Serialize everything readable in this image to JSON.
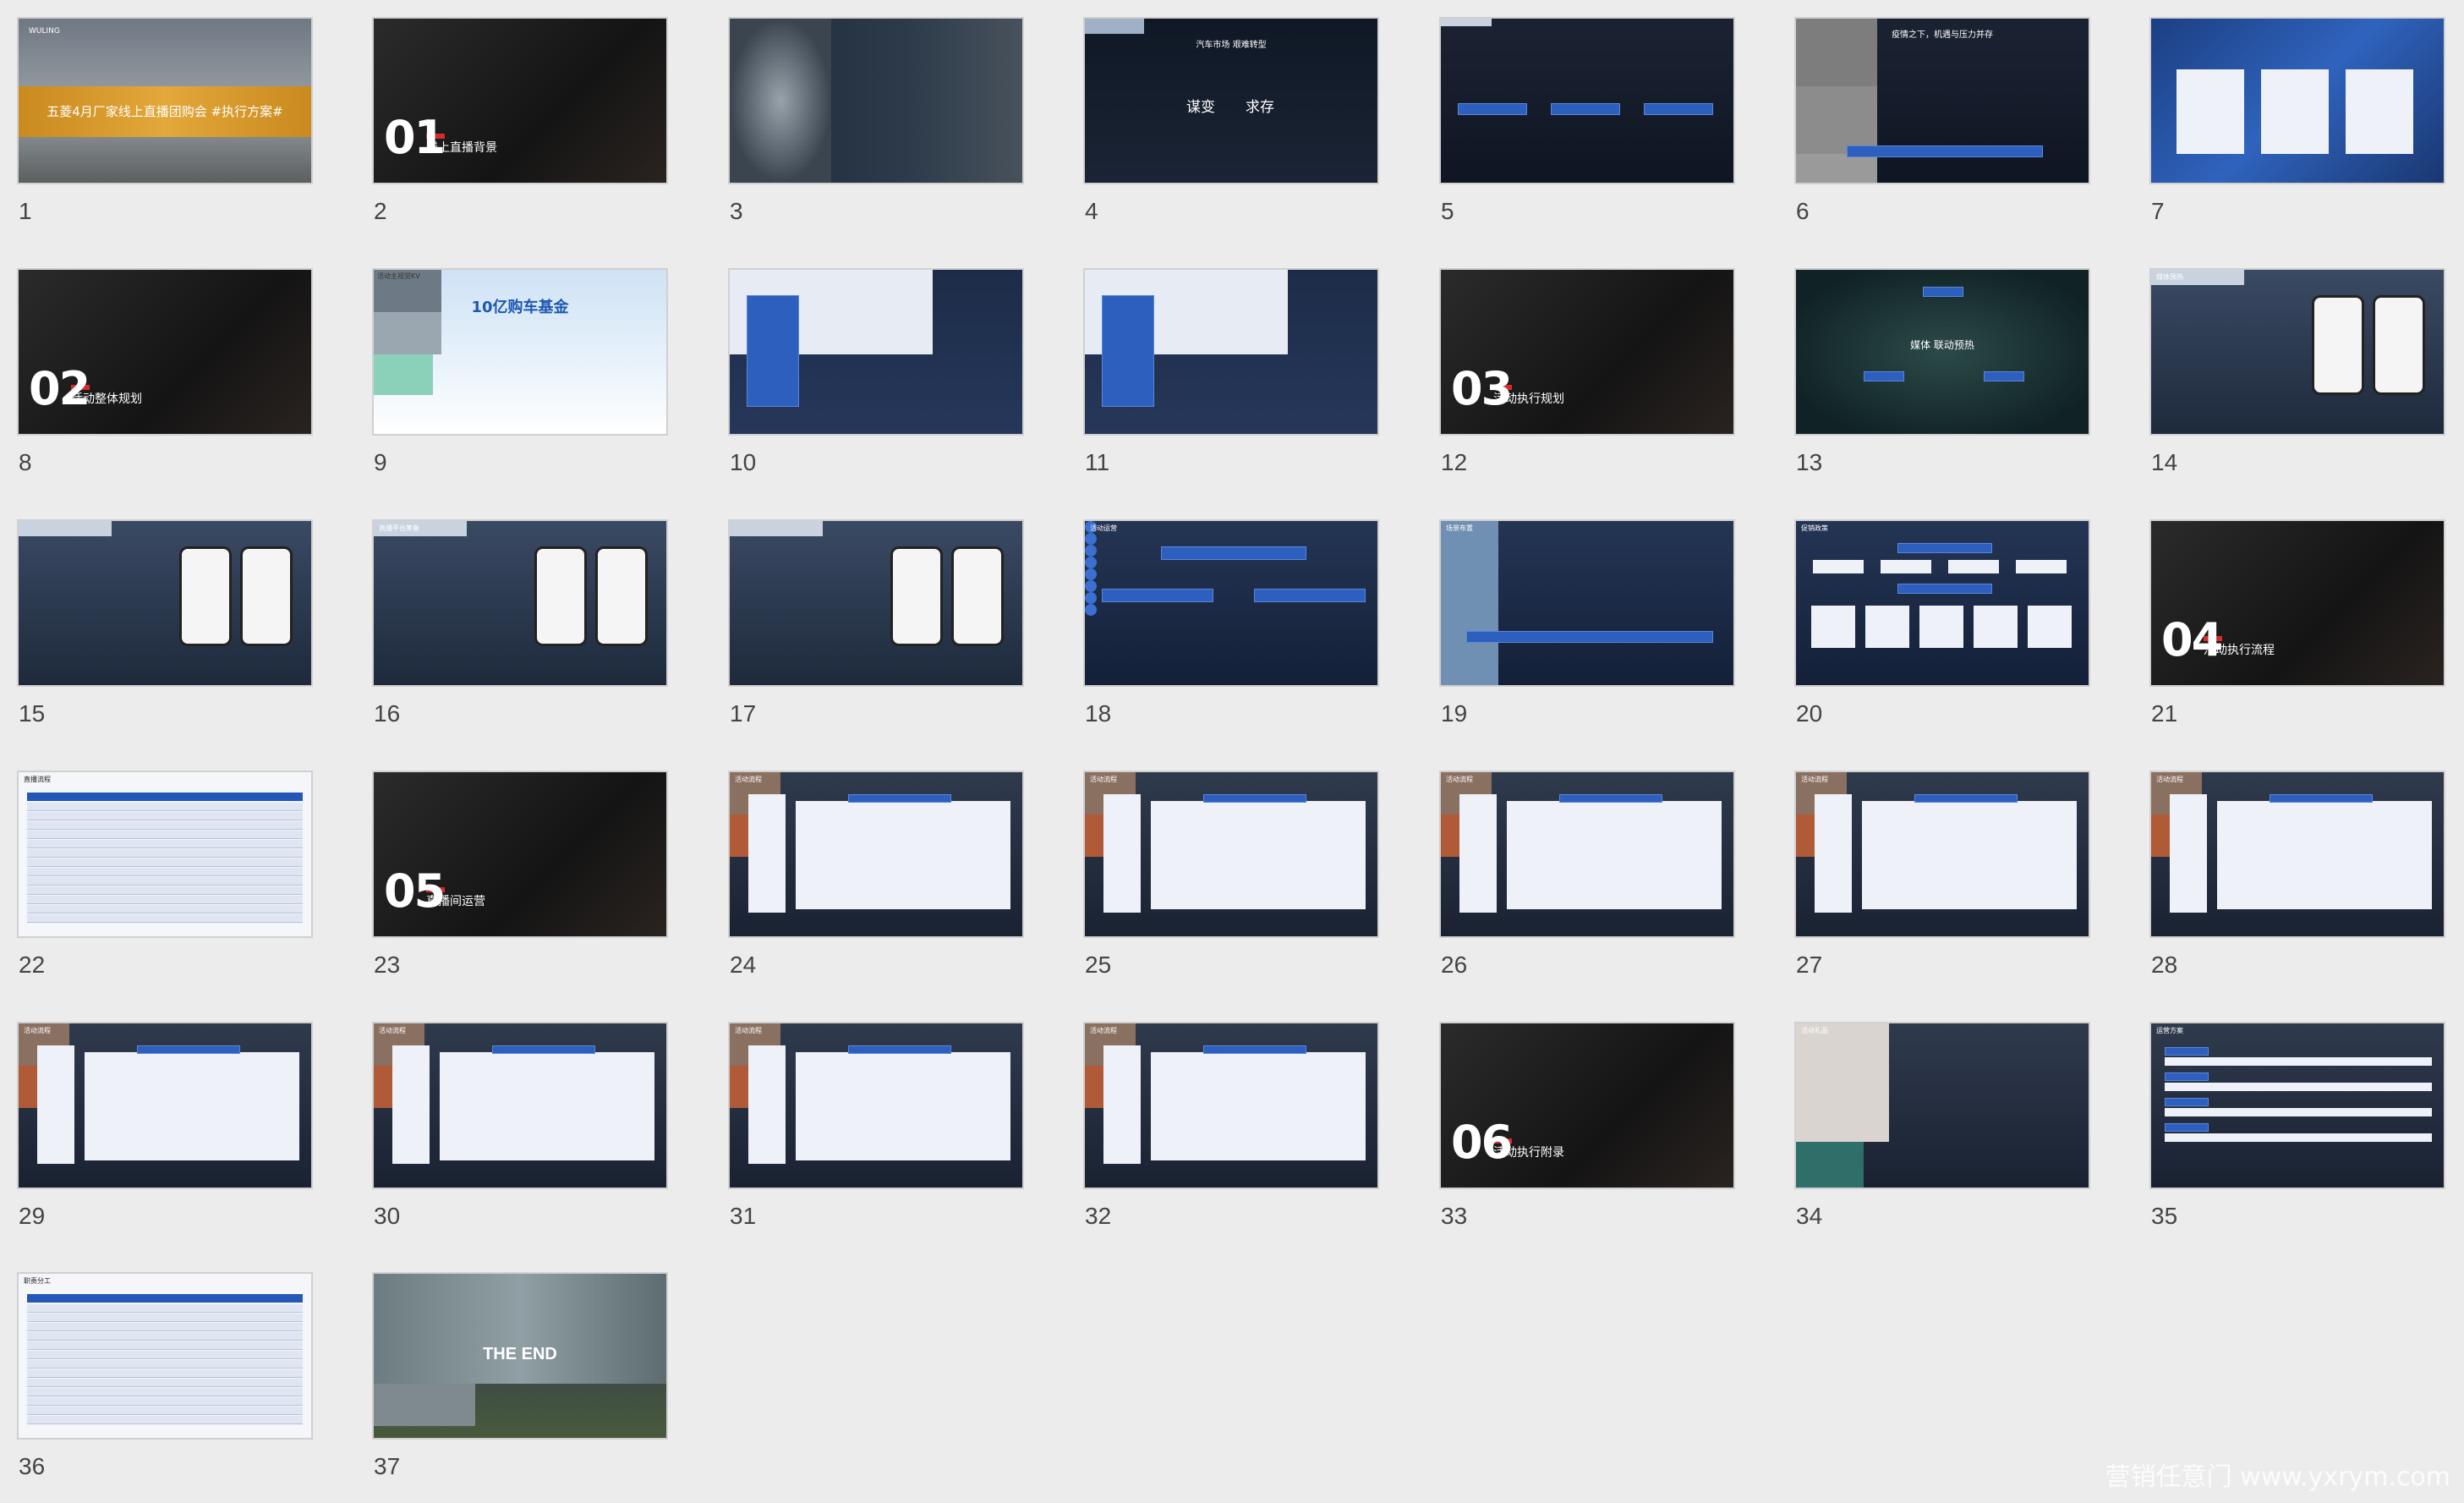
{
  "slides": [
    {
      "number": "1",
      "kind": "title",
      "text": "五菱4月厂家线上直播团购会    #执行方案#",
      "logo": "WULING"
    },
    {
      "number": "2",
      "kind": "section",
      "section": "01",
      "text": "线上直播背景"
    },
    {
      "number": "3",
      "kind": "photo-text"
    },
    {
      "number": "4",
      "kind": "headline",
      "text": "汽车市场 艰难转型",
      "words": [
        "谋变",
        "求存"
      ]
    },
    {
      "number": "5",
      "kind": "dark-boxes"
    },
    {
      "number": "6",
      "kind": "dark-boxes",
      "text": "疫情之下，机遇与压力并存"
    },
    {
      "number": "7",
      "kind": "blue-photo"
    },
    {
      "number": "8",
      "kind": "section",
      "section": "02",
      "text": "活动整体规划"
    },
    {
      "number": "9",
      "kind": "kv",
      "text": "10亿购车基金",
      "label": "活动主视觉KV"
    },
    {
      "number": "10",
      "kind": "table-blue"
    },
    {
      "number": "11",
      "kind": "table-blue"
    },
    {
      "number": "12",
      "kind": "section",
      "section": "03",
      "text": "活动执行规划"
    },
    {
      "number": "13",
      "kind": "cycle",
      "text": "媒体 联动预热"
    },
    {
      "number": "14",
      "kind": "phone-layout",
      "label": "媒体预热"
    },
    {
      "number": "15",
      "kind": "phone-layout"
    },
    {
      "number": "16",
      "kind": "phone-layout",
      "label": "直播平台筹备"
    },
    {
      "number": "17",
      "kind": "phone-layout"
    },
    {
      "number": "18",
      "kind": "flow",
      "label": "活动运营"
    },
    {
      "number": "19",
      "kind": "photo-grid",
      "label": "场景布置"
    },
    {
      "number": "20",
      "kind": "org",
      "label": "促销政策"
    },
    {
      "number": "21",
      "kind": "section",
      "section": "04",
      "text": "活动执行流程"
    },
    {
      "number": "22",
      "kind": "table",
      "label": "直播流程"
    },
    {
      "number": "23",
      "kind": "section",
      "section": "05",
      "text": "直播间运营"
    },
    {
      "number": "24",
      "kind": "menu-panel",
      "label": "活动流程"
    },
    {
      "number": "25",
      "kind": "menu-panel",
      "label": "活动流程"
    },
    {
      "number": "26",
      "kind": "menu-panel",
      "label": "活动流程"
    },
    {
      "number": "27",
      "kind": "menu-panel",
      "label": "活动流程"
    },
    {
      "number": "28",
      "kind": "menu-panel",
      "label": "活动流程"
    },
    {
      "number": "29",
      "kind": "menu-panel",
      "label": "活动流程"
    },
    {
      "number": "30",
      "kind": "menu-panel",
      "label": "活动流程"
    },
    {
      "number": "31",
      "kind": "menu-panel",
      "label": "活动流程"
    },
    {
      "number": "32",
      "kind": "menu-panel",
      "label": "活动流程"
    },
    {
      "number": "33",
      "kind": "section",
      "section": "06",
      "text": "活动执行附录"
    },
    {
      "number": "34",
      "kind": "gift-grid",
      "label": "活动礼品"
    },
    {
      "number": "35",
      "kind": "text-list",
      "label": "运营方案"
    },
    {
      "number": "36",
      "kind": "table",
      "label": "职责分工"
    },
    {
      "number": "37",
      "kind": "end",
      "text": "THE END"
    }
  ],
  "watermark": "营销任意门 www.yxrym.com"
}
